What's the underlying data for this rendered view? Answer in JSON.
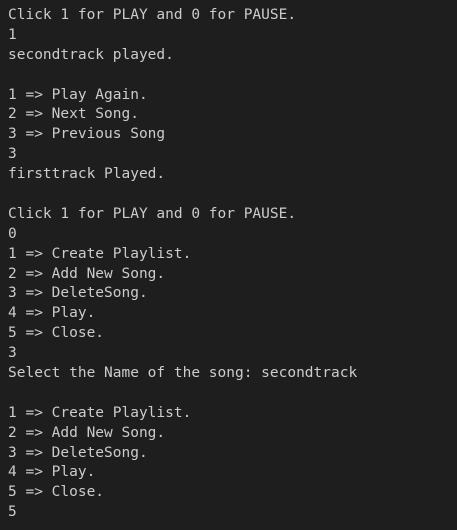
{
  "terminal": {
    "lines": [
      "Click 1 for PLAY and 0 for PAUSE.",
      "1",
      "secondtrack played.",
      "",
      "1 => Play Again.",
      "2 => Next Song.",
      "3 => Previous Song",
      "3",
      "firsttrack Played.",
      "",
      "Click 1 for PLAY and 0 for PAUSE.",
      "0",
      "1 => Create Playlist.",
      "2 => Add New Song.",
      "3 => DeleteSong.",
      "4 => Play.",
      "5 => Close.",
      "3",
      "Select the Name of the song: secondtrack",
      "",
      "1 => Create Playlist.",
      "2 => Add New Song.",
      "3 => DeleteSong.",
      "4 => Play.",
      "5 => Close.",
      "5"
    ]
  },
  "colors": {
    "background": "#1e1e1e",
    "text": "#cccccc"
  }
}
